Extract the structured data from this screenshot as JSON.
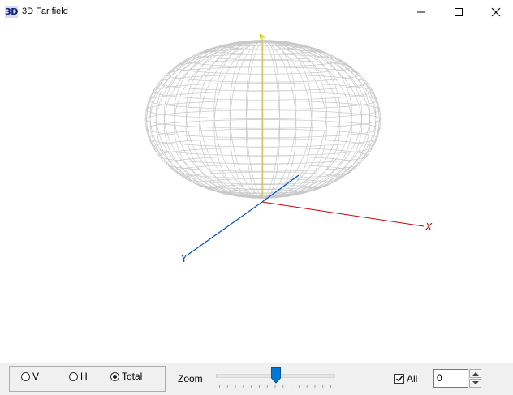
{
  "window": {
    "app_icon_text": "3D",
    "title": "3D Far field",
    "minimize_icon": "minimize-icon",
    "maximize_icon": "maximize-icon",
    "close_icon": "close-icon"
  },
  "plot": {
    "axes": {
      "x": {
        "label": "X",
        "color": "#cc0000"
      },
      "y": {
        "label": "Y",
        "color": "#0050d0"
      },
      "z": {
        "label": "Z",
        "color": "#c8c800"
      }
    },
    "mesh_color": "#c8c8c8"
  },
  "controls": {
    "polarization": {
      "options": [
        {
          "label": "V",
          "selected": false
        },
        {
          "label": "H",
          "selected": false
        },
        {
          "label": "Total",
          "selected": true
        }
      ]
    },
    "zoom": {
      "label": "Zoom",
      "position_fraction": 0.5
    },
    "all": {
      "label": "All",
      "checked": true
    },
    "spinner": {
      "value": "0"
    },
    "accent_color": "#0078d7"
  }
}
